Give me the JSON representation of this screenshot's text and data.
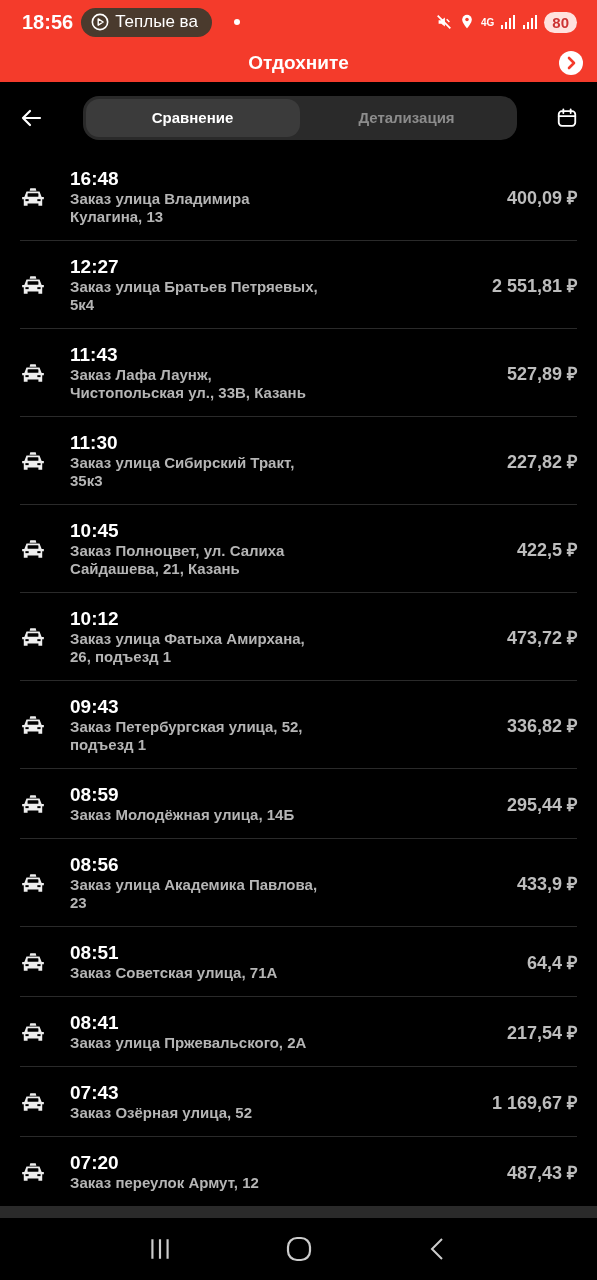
{
  "status_bar": {
    "time": "18:56",
    "media": "Теплые ва",
    "network": "4G",
    "battery": "80"
  },
  "banner": {
    "text": "Отдохните"
  },
  "tabs": [
    {
      "label": "Сравнение",
      "selected": true
    },
    {
      "label": "Детализация",
      "selected": false
    }
  ],
  "orders": [
    {
      "time": "16:48",
      "address": "Заказ улица Владимира Кулагина, 13",
      "price": "400,09 ₽"
    },
    {
      "time": "12:27",
      "address": "Заказ улица Братьев Петряевых, 5к4",
      "price": "2 551,81 ₽"
    },
    {
      "time": "11:43",
      "address": "Заказ Лафа Лаунж, Чистопольская ул., 33В, Казань",
      "price": "527,89 ₽"
    },
    {
      "time": "11:30",
      "address": "Заказ улица Сибирский Тракт, 35к3",
      "price": "227,82 ₽"
    },
    {
      "time": "10:45",
      "address": "Заказ Полноцвет, ул. Салиха Сайдашева, 21, Казань",
      "price": "422,5 ₽"
    },
    {
      "time": "10:12",
      "address": "Заказ улица Фатыха Амирхана, 26, подъезд 1",
      "price": "473,72 ₽"
    },
    {
      "time": "09:43",
      "address": "Заказ Петербургская улица, 52, подъезд 1",
      "price": "336,82 ₽"
    },
    {
      "time": "08:59",
      "address": "Заказ Молодёжная улица, 14Б",
      "price": "295,44 ₽"
    },
    {
      "time": "08:56",
      "address": "Заказ улица Академика Павлова, 23",
      "price": "433,9 ₽"
    },
    {
      "time": "08:51",
      "address": "Заказ Советская улица, 71А",
      "price": "64,4 ₽"
    },
    {
      "time": "08:41",
      "address": "Заказ улица Пржевальского, 2А",
      "price": "217,54 ₽"
    },
    {
      "time": "07:43",
      "address": "Заказ Озёрная улица, 52",
      "price": "1 169,67 ₽"
    },
    {
      "time": "07:20",
      "address": "Заказ переулок Армут, 12",
      "price": "487,43 ₽"
    }
  ]
}
